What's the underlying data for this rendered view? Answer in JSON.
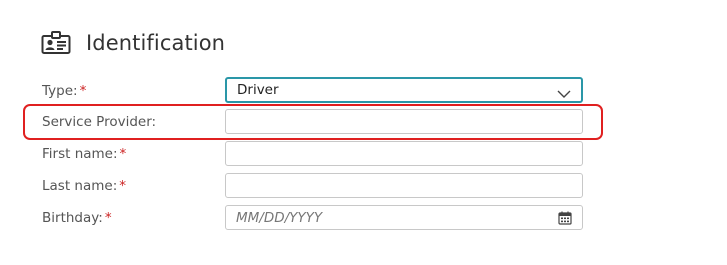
{
  "section": {
    "title": "Identification",
    "icon": "id-card-icon"
  },
  "form": {
    "type": {
      "label": "Type:",
      "required_mark": "*",
      "value": "Driver",
      "icon": "chevron-down-icon"
    },
    "service_provider": {
      "label": "Service Provider:",
      "value": "",
      "highlighted": true,
      "highlight_color": "#e02020"
    },
    "first_name": {
      "label": "First name:",
      "required_mark": "*",
      "value": ""
    },
    "last_name": {
      "label": "Last name:",
      "required_mark": "*",
      "value": ""
    },
    "birthday": {
      "label": "Birthday:",
      "required_mark": "*",
      "placeholder": "MM/DD/YYYY",
      "icon": "calendar-icon"
    }
  },
  "colors": {
    "accent": "#2a97a8",
    "required": "#cc2222"
  }
}
